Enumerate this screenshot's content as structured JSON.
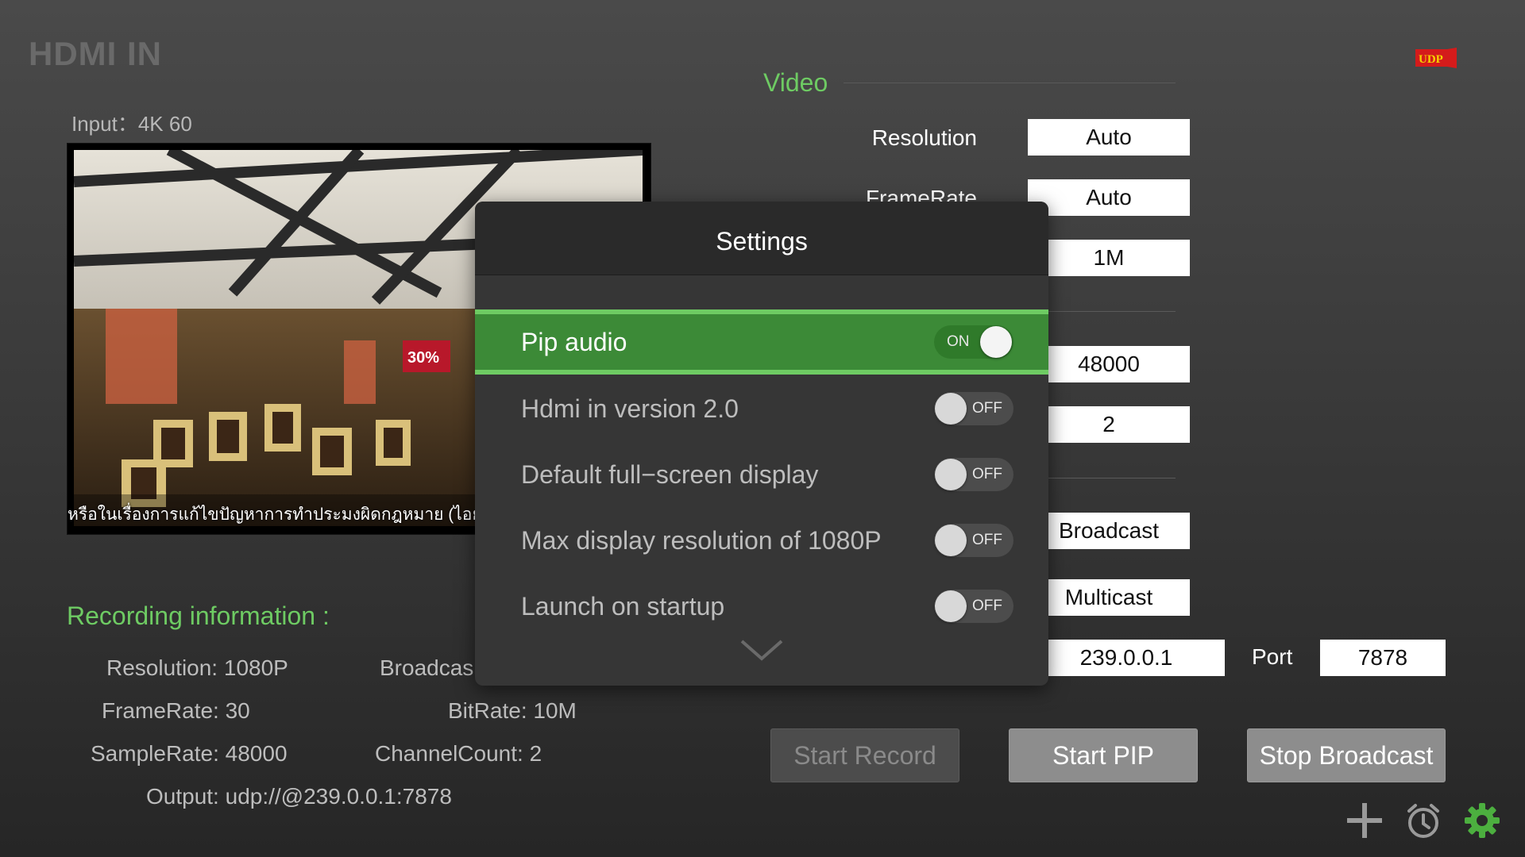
{
  "app": {
    "title": "HDMI IN",
    "udp_badge": "UDP"
  },
  "input": {
    "label": "Input：4K 60"
  },
  "video_preview": {
    "caption": "หรือในเรื่องการแก้ไขปัญหาการทำประมงผิดกฎหมาย (ไอยูยู ฟิชชิ่ง) อ"
  },
  "video_section": {
    "title": "Video",
    "rows": [
      {
        "label": "Resolution",
        "value": "Auto"
      },
      {
        "label": "FrameRate",
        "value": "Auto"
      },
      {
        "label": "",
        "value": "1M"
      }
    ]
  },
  "audio_section": {
    "rows": [
      {
        "value": "48000"
      },
      {
        "value": "2"
      }
    ]
  },
  "output_section": {
    "rows": [
      {
        "value": "Broadcast"
      },
      {
        "value": "Multicast"
      }
    ],
    "ip_value": "239.0.0.1",
    "port_label": "Port",
    "port_value": "7878"
  },
  "recording": {
    "title": "Recording information :",
    "resolution_k": "Resolution:",
    "resolution_v": "1080P",
    "broadcast_k": "Broadcas",
    "framerate_k": "FrameRate:",
    "framerate_v": "30",
    "bitrate_k": "BitRate:",
    "bitrate_v": "10M",
    "samplerate_k": "SampleRate:",
    "samplerate_v": "48000",
    "channel_k": "ChannelCount:",
    "channel_v": "2",
    "output_k": "Output:",
    "output_v": "udp://@239.0.0.1:7878"
  },
  "buttons": {
    "start_record": "Start Record",
    "start_pip": "Start PIP",
    "stop_broadcast": "Stop Broadcast"
  },
  "icons": [
    "plus-icon",
    "alarm-clock-icon",
    "gear-icon"
  ],
  "settings_modal": {
    "title": "Settings",
    "items": [
      {
        "label": "Pip audio",
        "state": "ON",
        "on": true
      },
      {
        "label": "Hdmi in version 2.0",
        "state": "OFF",
        "on": false
      },
      {
        "label": "Default full−screen display",
        "state": "OFF",
        "on": false
      },
      {
        "label": "Max display resolution of 1080P",
        "state": "OFF",
        "on": false
      },
      {
        "label": "Launch on startup",
        "state": "OFF",
        "on": false
      }
    ]
  },
  "colors": {
    "accent_green": "#6ecb63",
    "active_row_green": "#3c8a37",
    "udp_badge_red": "#d41b1b",
    "udp_badge_text": "#f5d300"
  }
}
